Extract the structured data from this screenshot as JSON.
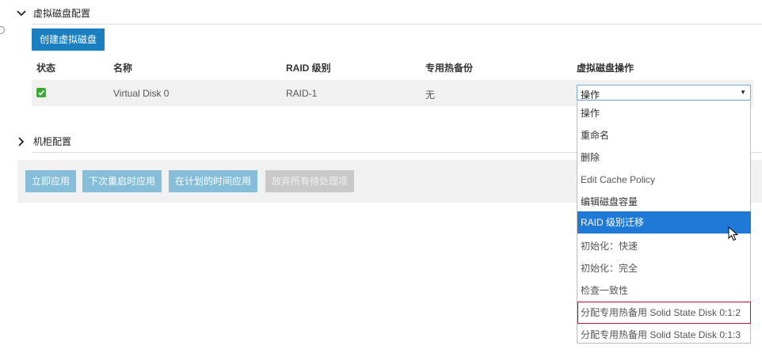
{
  "virtual_disk_section": {
    "title": "虚拟磁盘配置",
    "create_button": "创建虚拟磁盘",
    "columns": [
      "状态",
      "名称",
      "RAID 级别",
      "专用热备份",
      "虚拟磁盘操作"
    ],
    "rows": [
      {
        "status": "ok",
        "name": "Virtual Disk 0",
        "raid_level": "RAID-1",
        "hot_spare": "无"
      }
    ],
    "action_select": {
      "value": "操作",
      "options": [
        "操作",
        "重命名",
        "删除",
        "Edit Cache Policy",
        "编辑磁盘容量",
        "RAID 级别迁移",
        "初始化：快速",
        "初始化：完全",
        "检查一致性",
        "分配专用热备用 Solid State Disk 0:1:2",
        "分配专用热备用 Solid State Disk 0:1:3"
      ],
      "highlighted": "RAID 级别迁移"
    }
  },
  "enclosure_section": {
    "title": "机柜配置"
  },
  "action_bar": {
    "apply_now": "立即应用",
    "apply_next_reboot": "下次重启时应用",
    "apply_scheduled": "在计划的时间应用",
    "discard_pending": "放弃所有待处理项"
  },
  "colors": {
    "primary": "#1a7fbf",
    "action_button": "#86bdd8",
    "disabled_button": "#c9c9c9",
    "status_ok": "#3aaa35",
    "dropdown_highlight": "#1e7ad6",
    "focus_outline": "#c0102c"
  }
}
